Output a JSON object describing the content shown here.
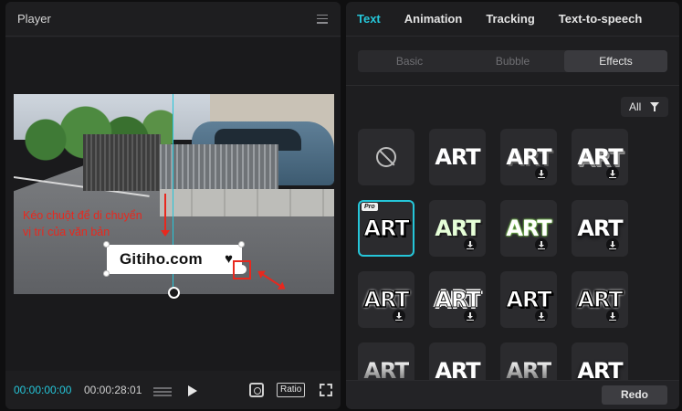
{
  "player": {
    "title": "Player",
    "hint_line1": "Kéo chuột để di chuyển",
    "hint_line2": "vị trí của văn bản",
    "overlay_text": "Gitiho.com",
    "overlay_symbol": "♥",
    "time_current": "00:00:00:00",
    "time_total": "00:00:28:01",
    "ratio_label": "Ratio"
  },
  "panel": {
    "tabs": [
      "Text",
      "Animation",
      "Tracking",
      "Text-to-speech"
    ],
    "active_tab": "Text",
    "subtabs": [
      "Basic",
      "Bubble",
      "Effects"
    ],
    "active_subtab": "Effects",
    "filter_label": "All",
    "tiles": [
      {
        "kind": "none"
      },
      {
        "label": "ART",
        "style": "s1",
        "download": false
      },
      {
        "label": "ART",
        "style": "s2",
        "download": true
      },
      {
        "label": "ART",
        "style": "s3",
        "download": true
      },
      {
        "label": "ART",
        "style": "s4",
        "download": false,
        "badge": "Pro",
        "selected": true
      },
      {
        "label": "ART",
        "style": "s5",
        "download": true
      },
      {
        "label": "ART",
        "style": "s6",
        "download": true
      },
      {
        "label": "ART",
        "style": "s10",
        "download": true
      },
      {
        "label": "ART",
        "style": "s7",
        "download": true
      },
      {
        "label": "ART",
        "style": "s8",
        "download": true
      },
      {
        "label": "ART",
        "style": "s4",
        "download": true
      },
      {
        "label": "ART",
        "style": "s7",
        "download": true
      },
      {
        "label": "ART",
        "style": "s9",
        "download": false
      },
      {
        "label": "ART",
        "style": "s1",
        "download": false
      },
      {
        "label": "ART",
        "style": "s9",
        "download": false
      },
      {
        "label": "ART",
        "style": "s10",
        "download": false
      }
    ],
    "redo_label": "Redo"
  },
  "colors": {
    "accent": "#25c6d9",
    "annotation": "#e8281e"
  }
}
